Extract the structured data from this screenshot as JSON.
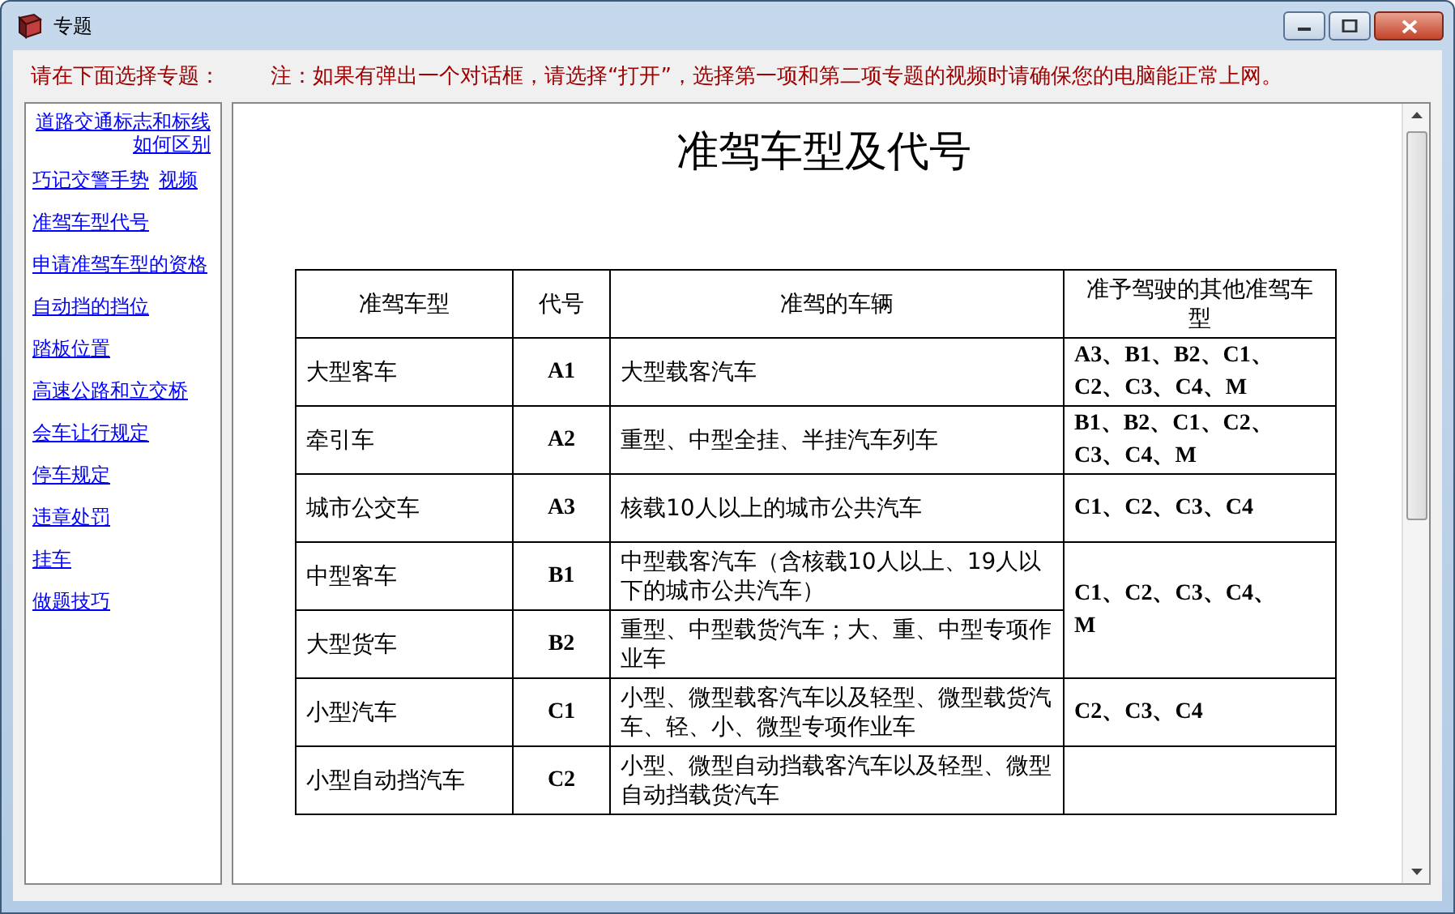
{
  "window": {
    "title": "专题"
  },
  "prompt": "请在下面选择专题：",
  "notice": "注：如果有弹出一个对话框，请选择“打开”，选择第一项和第二项专题的视频时请确保您的电脑能正常上网。",
  "sidebar": {
    "items": [
      {
        "links": [
          "道路交通标志和标线如何区别"
        ]
      },
      {
        "links": [
          "巧记交警手势",
          "视频"
        ]
      },
      {
        "links": [
          "准驾车型代号"
        ]
      },
      {
        "links": [
          "申请准驾车型的资格"
        ]
      },
      {
        "links": [
          "自动挡的挡位"
        ]
      },
      {
        "links": [
          "踏板位置"
        ]
      },
      {
        "links": [
          "高速公路和立交桥"
        ]
      },
      {
        "links": [
          "会车让行规定"
        ]
      },
      {
        "links": [
          "停车规定"
        ]
      },
      {
        "links": [
          "违章处罚"
        ]
      },
      {
        "links": [
          "挂车"
        ]
      },
      {
        "links": [
          "做题技巧"
        ]
      }
    ]
  },
  "document": {
    "title": "准驾车型及代号",
    "table": {
      "columns": [
        "准驾车型",
        "代号",
        "准驾的车辆",
        "准予驾驶的其他准驾车型"
      ],
      "rows": [
        {
          "model": "大型客车",
          "code": "A1",
          "vehicles": "大型载客汽车",
          "others": "A3、B1、B2、C1、C2、C3、C4、M"
        },
        {
          "model": "牵引车",
          "code": "A2",
          "vehicles": "重型、中型全挂、半挂汽车列车",
          "others": "B1、B2、C1、C2、C3、C4、M"
        },
        {
          "model": "城市公交车",
          "code": "A3",
          "vehicles": "核载10人以上的城市公共汽车",
          "others": "C1、C2、C3、C4"
        },
        {
          "model": "中型客车",
          "code": "B1",
          "vehicles": "中型载客汽车（含核载10人以上、19人以下的城市公共汽车）",
          "others": "C1、C2、C3、C4、M",
          "merged_with_next": true
        },
        {
          "model": "大型货车",
          "code": "B2",
          "vehicles": "重型、中型载货汽车；大、重、中型专项作业车"
        },
        {
          "model": "小型汽车",
          "code": "C1",
          "vehicles": "小型、微型载客汽车以及轻型、微型载货汽车、轻、小、微型专项作业车",
          "others": "C2、C3、C4"
        },
        {
          "model": "小型自动挡汽车",
          "code": "C2",
          "vehicles": "小型、微型自动挡载客汽车以及轻型、微型自动挡载货汽车"
        }
      ]
    }
  }
}
